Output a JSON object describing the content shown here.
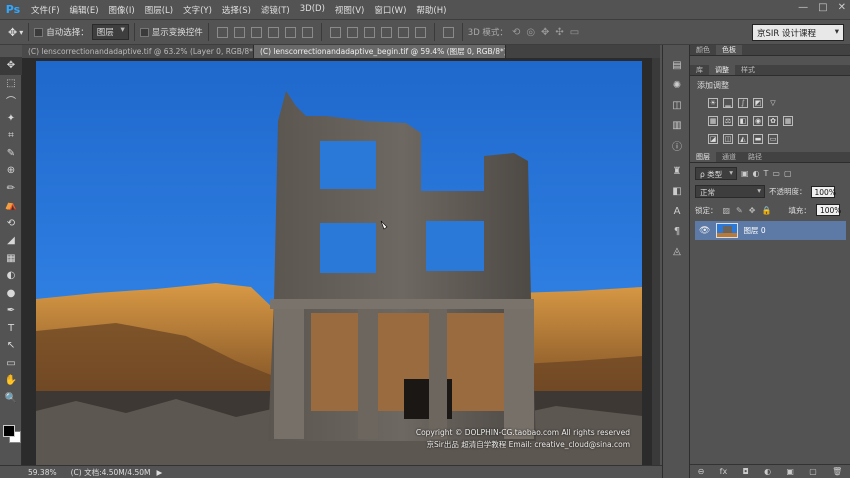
{
  "app": {
    "logo": "Ps"
  },
  "menu": [
    "文件(F)",
    "编辑(E)",
    "图像(I)",
    "图层(L)",
    "文字(Y)",
    "选择(S)",
    "滤镜(T)",
    "3D(D)",
    "视图(V)",
    "窗口(W)",
    "帮助(H)"
  ],
  "window_controls": [
    "—",
    "□",
    "✕"
  ],
  "options": {
    "auto_select_label": "自动选择：",
    "auto_select_target": "图层",
    "show_transform_label": "显示变换控件",
    "mode_3d_label": "3D 模式：",
    "workspace": "京SIR 设计课程"
  },
  "tabs": [
    {
      "label": "(C) lenscorrectionandadaptive.tif @ 63.2% (Layer 0, RGB/8*)",
      "close": "×",
      "active": false
    },
    {
      "label": "(C) lenscorrectionandadaptive_begin.tif @ 59.4% (图层 0, RGB/8*) *",
      "close": "×",
      "active": true
    }
  ],
  "tools": [
    "✥",
    "⬚",
    "⌒",
    "✦",
    "⌗",
    "✎",
    "⊕",
    "✏",
    "⛺",
    "⟲",
    "◢",
    "▦",
    "◐",
    "●",
    "✒",
    "T",
    "↖",
    "▭",
    "✋",
    "🔍"
  ],
  "status": {
    "zoom": "59.38%",
    "doc": "(C) 文档:4.50M/4.50M",
    "arrow": "▶"
  },
  "watermark": {
    "line1": "Copyright © DOLPHIN-CG.taobao.com All rights reserved",
    "line2": "京Sir出品  超清自学教程  Email: creative_cloud@sina.com"
  },
  "panels": {
    "top_tabs": [
      "颜色",
      "色板"
    ],
    "mid_tabs": [
      "库",
      "调整",
      "样式"
    ],
    "adjust_title": "添加调整",
    "layer_tabs": [
      "图层",
      "通道",
      "路径"
    ],
    "filter_kind": "ρ 类型",
    "blend_mode": "正常",
    "opacity_label": "不透明度：",
    "opacity_value": "100%",
    "lock_label": "锁定：",
    "fill_label": "填充：",
    "fill_value": "100%",
    "layer_name": "图层 0",
    "footer_icons": [
      "⊖",
      "fx",
      "◘",
      "◐",
      "▣",
      "▢",
      "🗑"
    ]
  },
  "colors": {
    "accent": "#31a8ff",
    "selected_layer": "#5d7aa6",
    "sky": "#2a78d8"
  }
}
